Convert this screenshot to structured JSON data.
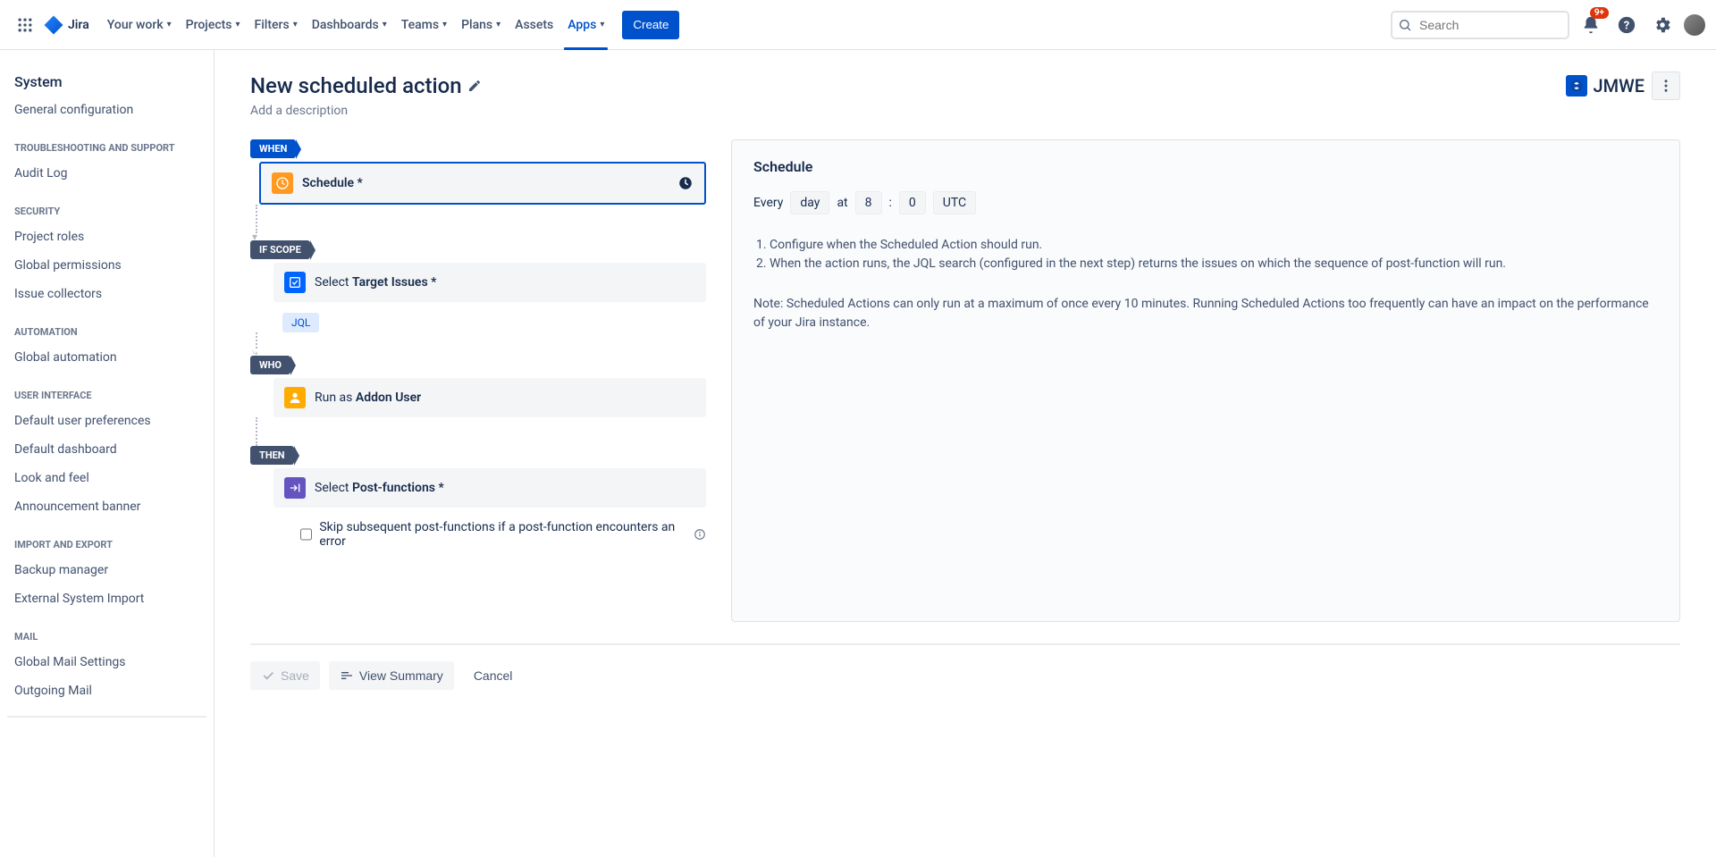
{
  "nav": {
    "product": "Jira",
    "items": [
      "Your work",
      "Projects",
      "Filters",
      "Dashboards",
      "Teams",
      "Plans",
      "Assets",
      "Apps"
    ],
    "active": "Apps",
    "create": "Create",
    "search_placeholder": "Search",
    "notification_badge": "9+"
  },
  "sidebar": {
    "title": "System",
    "groups": [
      {
        "heading": null,
        "items": [
          "General configuration"
        ]
      },
      {
        "heading": "TROUBLESHOOTING AND SUPPORT",
        "items": [
          "Audit Log"
        ]
      },
      {
        "heading": "SECURITY",
        "items": [
          "Project roles",
          "Global permissions",
          "Issue collectors"
        ]
      },
      {
        "heading": "AUTOMATION",
        "items": [
          "Global automation"
        ]
      },
      {
        "heading": "USER INTERFACE",
        "items": [
          "Default user preferences",
          "Default dashboard",
          "Look and feel",
          "Announcement banner"
        ]
      },
      {
        "heading": "IMPORT AND EXPORT",
        "items": [
          "Backup manager",
          "External System Import"
        ]
      },
      {
        "heading": "MAIL",
        "items": [
          "Global Mail Settings",
          "Outgoing Mail"
        ]
      }
    ]
  },
  "page": {
    "title": "New scheduled action",
    "description_placeholder": "Add a description",
    "app_name": "JMWE"
  },
  "flow": {
    "when_tag": "WHEN",
    "schedule_label": "Schedule *",
    "ifscope_tag": "IF SCOPE",
    "target_prefix": "Select ",
    "target_bold": "Target Issues *",
    "jql_chip": "JQL",
    "who_tag": "WHO",
    "runas_prefix": "Run as ",
    "runas_bold": "Addon User",
    "then_tag": "THEN",
    "postfn_prefix": "Select ",
    "postfn_bold": "Post-functions *",
    "skip_label": "Skip subsequent post-functions if a post-function encounters an error"
  },
  "detail": {
    "heading": "Schedule",
    "every": "Every",
    "unit": "day",
    "at": "at",
    "hour": "8",
    "colon": ":",
    "minute": "0",
    "tz": "UTC",
    "list_1": "Configure when the Scheduled Action should run.",
    "list_2": "When the action runs, the JQL search (configured in the next step) returns the issues on which the sequence of post-function will run.",
    "note": "Note: Scheduled Actions can only run at a maximum of once every 10 minutes. Running Scheduled Actions too frequently can have an impact on the performance of your Jira instance."
  },
  "footer": {
    "save": "Save",
    "view_summary": "View Summary",
    "cancel": "Cancel"
  }
}
